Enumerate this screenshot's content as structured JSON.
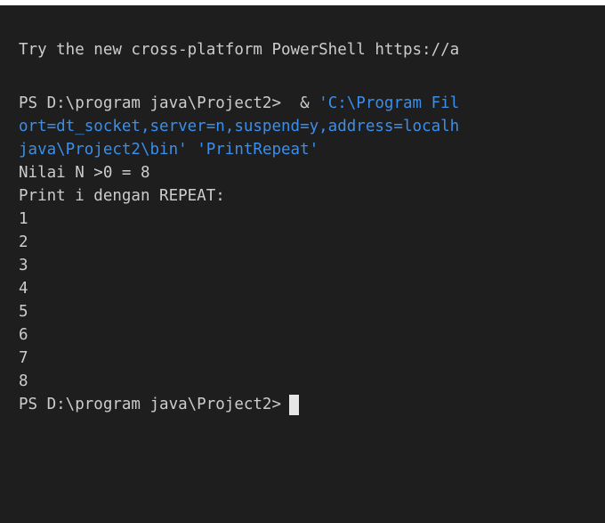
{
  "terminal": {
    "banner": "Try the new cross-platform PowerShell https://a",
    "command": {
      "prompt": "PS D:\\program java\\Project2>  & ",
      "arg_part1": "'C:\\Program Fil",
      "arg_part2": "ort=dt_socket,server=n,suspend=y,address=localh",
      "arg_part3_path": "java\\Project2\\bin'",
      "arg_part3_space": " ",
      "arg_part3_class": "'PrintRepeat'"
    },
    "output": [
      "Nilai N >0 = 8",
      "Print i dengan REPEAT:",
      "1",
      "2",
      "3",
      "4",
      "5",
      "6",
      "7",
      "8"
    ],
    "final_prompt": "PS D:\\program java\\Project2>"
  },
  "colors": {
    "background": "#1e1e1e",
    "text": "#cccccc",
    "string": "#3b8eea",
    "cursor": "#e6e6e6"
  }
}
